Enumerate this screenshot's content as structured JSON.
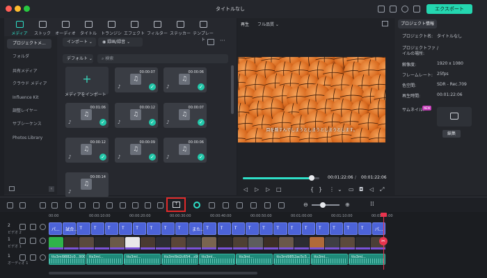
{
  "window": {
    "title": "タイトルなし",
    "export_label": "エクスポート"
  },
  "tabs": [
    {
      "label": "メディア",
      "active": true,
      "icon": "media-icon"
    },
    {
      "label": "ストック",
      "active": false,
      "icon": "stock-icon"
    },
    {
      "label": "オーディオ",
      "active": false,
      "icon": "music-note-icon"
    },
    {
      "label": "タイトル",
      "active": false,
      "icon": "text-icon"
    },
    {
      "label": "トランジション",
      "active": false,
      "icon": "transition-icon"
    },
    {
      "label": "エフェクト",
      "active": false,
      "icon": "effect-icon"
    },
    {
      "label": "フィルター",
      "active": false,
      "icon": "filter-icon"
    },
    {
      "label": "ステッカー",
      "active": false,
      "icon": "sticker-icon"
    },
    {
      "label": "テンプレート",
      "active": false,
      "icon": "template-icon"
    }
  ],
  "sidebar": {
    "items": [
      {
        "label": "プロジェクトメ...",
        "selected": true
      },
      {
        "label": "フォルダ",
        "selected": false
      },
      {
        "label": "共有メディア",
        "selected": false
      },
      {
        "label": "クラウド メディア",
        "selected": false
      },
      {
        "label": "Influence Kit",
        "selected": false
      },
      {
        "label": "調整レイヤー",
        "selected": false
      },
      {
        "label": "サブシーケンス",
        "selected": false
      },
      {
        "label": "Photos Library",
        "selected": false
      }
    ]
  },
  "media": {
    "import_label": "インポート",
    "record_label": "録画/録音",
    "sort_label": "デフォルト",
    "search_placeholder": "検索",
    "import_tile_label": "メディアをインポート",
    "items": [
      {
        "duration": "00:00:07"
      },
      {
        "duration": "00:00:06"
      },
      {
        "duration": "00:01:06"
      },
      {
        "duration": "00:00:12"
      },
      {
        "duration": "00:00:07"
      },
      {
        "duration": "00:00:12"
      },
      {
        "duration": "00:00:09"
      },
      {
        "duration": "00:00:06"
      },
      {
        "duration": "00:00:14"
      }
    ]
  },
  "player": {
    "play_label": "再生",
    "quality_label": "フル品質",
    "subtitle": "目を隠すんでしまうとしまうとしまうとします。",
    "current_time": "00:01:22:06",
    "total_time": "00:01:22:06",
    "progress": 0.9
  },
  "properties": {
    "tab_label": "プロジェクト情報",
    "rows": [
      {
        "key": "プロジェクト名:",
        "value": "タイトルなし"
      },
      {
        "key": "プロジェクトファイルの場所:",
        "value": "/"
      },
      {
        "key": "解像度:",
        "value": "1920 x 1080"
      },
      {
        "key": "フレームレート:",
        "value": "25fps"
      },
      {
        "key": "色空間:",
        "value": "SDR - Rec.709"
      },
      {
        "key": "再生時間:",
        "value": "00:01:22:06"
      }
    ],
    "thumbnail_label": "サムネイル:",
    "thumbnail_badge": "NEW",
    "edit_label": "編集"
  },
  "timeline": {
    "ruler": [
      "00:00",
      "00:00:10:00",
      "00:00:20:00",
      "00:00:30:00",
      "00:00:40:00",
      "00:00:50:00",
      "00:01:00:00",
      "00:01:10:00",
      "00:01:20:00"
    ],
    "tracks": [
      {
        "num": "2",
        "name": "ビデオ 2"
      },
      {
        "num": "1",
        "name": "ビデオ 1"
      },
      {
        "num": "1",
        "name": "オーディオ 1"
      }
    ],
    "title_clip_labels": [
      "パ...",
      "試合...",
      "T",
      "T",
      "T",
      "T",
      "T",
      "T",
      "T",
      "T",
      "また...",
      "T",
      "T",
      "T",
      "T",
      "T",
      "T",
      "T",
      "T",
      "T",
      "T",
      "T",
      "T",
      "パ..."
    ],
    "audio_clip_labels": [
      "tts3ml9882c0...9000s",
      "tts3ml...",
      "tts3ml...",
      "tts3ml9d2c654...s9",
      "tts3ml...",
      "tts3ml...",
      "tts3ml9852ac5c5...",
      "tts3ml...",
      "tts3ml..."
    ],
    "playhead_progress": 1.0
  },
  "colors": {
    "accent": "#2ee0c8",
    "highlight": "#e12a2a",
    "title_clip": "#4c63d8",
    "audio_clip": "#1f8a7a"
  }
}
